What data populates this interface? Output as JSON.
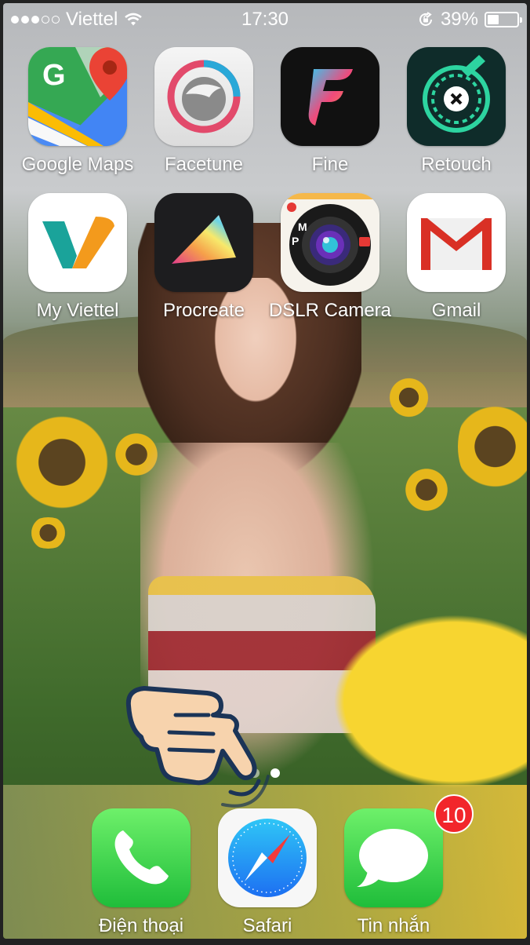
{
  "status_bar": {
    "carrier": "Viettel",
    "time": "17:30",
    "battery_percent": "39%",
    "battery_level": 0.39,
    "signal_strength": 3,
    "signal_max": 5
  },
  "home": {
    "apps": [
      {
        "label": "Google Maps",
        "icon": "google-maps-icon"
      },
      {
        "label": "Facetune",
        "icon": "facetune-icon"
      },
      {
        "label": "Fine",
        "icon": "fine-icon"
      },
      {
        "label": "Retouch",
        "icon": "retouch-icon"
      },
      {
        "label": "My Viettel",
        "icon": "my-viettel-icon"
      },
      {
        "label": "Procreate",
        "icon": "procreate-icon"
      },
      {
        "label": "DSLR Camera",
        "icon": "dslr-camera-icon"
      },
      {
        "label": "Gmail",
        "icon": "gmail-icon"
      }
    ],
    "page_count": 2,
    "active_page": 2
  },
  "dock": {
    "apps": [
      {
        "label": "Điện thoại",
        "icon": "phone-icon"
      },
      {
        "label": "Safari",
        "icon": "safari-icon"
      },
      {
        "label": "Tin nhắn",
        "icon": "messages-icon",
        "badge": "10"
      }
    ]
  },
  "overlay": {
    "icon": "pointing-hand-icon"
  }
}
